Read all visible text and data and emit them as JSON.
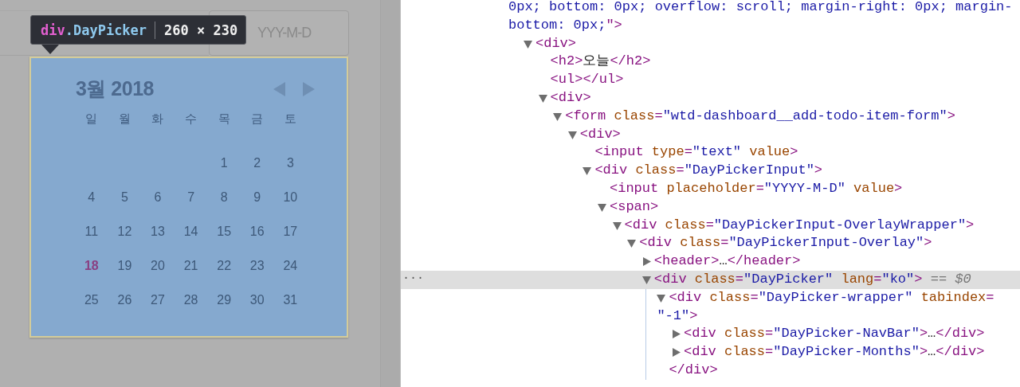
{
  "page": {
    "date_field": {
      "placeholder": "YYY-M-D"
    },
    "inspect_tooltip": {
      "tag": "div",
      "class_name": ".DayPicker",
      "size": "260 × 230"
    },
    "day_picker": {
      "caption": "3월 2018",
      "weekdays": [
        "일",
        "월",
        "화",
        "수",
        "목",
        "금",
        "토"
      ],
      "days": [
        {
          "kind": "blank"
        },
        {
          "kind": "blank"
        },
        {
          "kind": "blank"
        },
        {
          "kind": "blank"
        },
        {
          "kind": "day",
          "label": "1",
          "today": false
        },
        {
          "kind": "day",
          "label": "2",
          "today": false
        },
        {
          "kind": "day",
          "label": "3",
          "today": false
        },
        {
          "kind": "day",
          "label": "4",
          "today": false
        },
        {
          "kind": "day",
          "label": "5",
          "today": false
        },
        {
          "kind": "day",
          "label": "6",
          "today": false
        },
        {
          "kind": "day",
          "label": "7",
          "today": false
        },
        {
          "kind": "day",
          "label": "8",
          "today": false
        },
        {
          "kind": "day",
          "label": "9",
          "today": false
        },
        {
          "kind": "day",
          "label": "10",
          "today": false
        },
        {
          "kind": "day",
          "label": "11",
          "today": false
        },
        {
          "kind": "day",
          "label": "12",
          "today": false
        },
        {
          "kind": "day",
          "label": "13",
          "today": false
        },
        {
          "kind": "day",
          "label": "14",
          "today": false
        },
        {
          "kind": "day",
          "label": "15",
          "today": false
        },
        {
          "kind": "day",
          "label": "16",
          "today": false
        },
        {
          "kind": "day",
          "label": "17",
          "today": false
        },
        {
          "kind": "day",
          "label": "18",
          "today": true
        },
        {
          "kind": "day",
          "label": "19",
          "today": false
        },
        {
          "kind": "day",
          "label": "20",
          "today": false
        },
        {
          "kind": "day",
          "label": "21",
          "today": false
        },
        {
          "kind": "day",
          "label": "22",
          "today": false
        },
        {
          "kind": "day",
          "label": "23",
          "today": false
        },
        {
          "kind": "day",
          "label": "24",
          "today": false
        },
        {
          "kind": "day",
          "label": "25",
          "today": false
        },
        {
          "kind": "day",
          "label": "26",
          "today": false
        },
        {
          "kind": "day",
          "label": "27",
          "today": false
        },
        {
          "kind": "day",
          "label": "28",
          "today": false
        },
        {
          "kind": "day",
          "label": "29",
          "today": false
        },
        {
          "kind": "day",
          "label": "30",
          "today": false
        },
        {
          "kind": "day",
          "label": "31",
          "today": false
        }
      ]
    }
  },
  "elements_tree": {
    "selected_marker": "...",
    "root": {
      "selected": false,
      "lines": [
        [
          {
            "kind": "value",
            "text": "0px; bottom: 0px; overflow: scroll; margin-right: 0px; margin-"
          }
        ],
        [
          {
            "kind": "value",
            "text": "bottom: 0px;"
          },
          {
            "kind": "tag",
            "text": "\">"
          }
        ]
      ],
      "children": [
        {
          "selected": false,
          "expanded": true,
          "lines": [
            [
              {
                "kind": "tag",
                "text": "<div>"
              }
            ]
          ],
          "children": [
            {
              "selected": false,
              "lines": [
                [
                  {
                    "kind": "tag",
                    "text": "<h2>"
                  },
                  {
                    "kind": "text",
                    "text": "오늘"
                  },
                  {
                    "kind": "tag",
                    "text": "</h2>"
                  }
                ]
              ]
            },
            {
              "selected": false,
              "lines": [
                [
                  {
                    "kind": "tag",
                    "text": "<ul></ul>"
                  }
                ]
              ]
            },
            {
              "selected": false,
              "expanded": true,
              "lines": [
                [
                  {
                    "kind": "tag",
                    "text": "<div>"
                  }
                ]
              ],
              "children": [
                {
                  "selected": false,
                  "expanded": true,
                  "lines": [
                    [
                      {
                        "kind": "tag",
                        "text": "<form"
                      },
                      {
                        "kind": "attr",
                        "text": " class"
                      },
                      {
                        "kind": "tag",
                        "text": "="
                      },
                      {
                        "kind": "value",
                        "text": "\"wtd-dashboard__add-todo-item-form\""
                      },
                      {
                        "kind": "tag",
                        "text": ">"
                      }
                    ]
                  ],
                  "children": [
                    {
                      "selected": false,
                      "expanded": true,
                      "lines": [
                        [
                          {
                            "kind": "tag",
                            "text": "<div>"
                          }
                        ]
                      ],
                      "children": [
                        {
                          "selected": false,
                          "lines": [
                            [
                              {
                                "kind": "tag",
                                "text": "<input"
                              },
                              {
                                "kind": "attr",
                                "text": " type"
                              },
                              {
                                "kind": "tag",
                                "text": "="
                              },
                              {
                                "kind": "value",
                                "text": "\"text\""
                              },
                              {
                                "kind": "attr",
                                "text": " value"
                              },
                              {
                                "kind": "tag",
                                "text": ">"
                              }
                            ]
                          ]
                        },
                        {
                          "selected": false,
                          "expanded": true,
                          "lines": [
                            [
                              {
                                "kind": "tag",
                                "text": "<div"
                              },
                              {
                                "kind": "attr",
                                "text": " class"
                              },
                              {
                                "kind": "tag",
                                "text": "="
                              },
                              {
                                "kind": "value",
                                "text": "\"DayPickerInput\""
                              },
                              {
                                "kind": "tag",
                                "text": ">"
                              }
                            ]
                          ],
                          "children": [
                            {
                              "selected": false,
                              "lines": [
                                [
                                  {
                                    "kind": "tag",
                                    "text": "<input"
                                  },
                                  {
                                    "kind": "attr",
                                    "text": " placeholder"
                                  },
                                  {
                                    "kind": "tag",
                                    "text": "="
                                  },
                                  {
                                    "kind": "value",
                                    "text": "\"YYYY-M-D\""
                                  },
                                  {
                                    "kind": "attr",
                                    "text": " value"
                                  },
                                  {
                                    "kind": "tag",
                                    "text": ">"
                                  }
                                ]
                              ]
                            },
                            {
                              "selected": false,
                              "expanded": true,
                              "lines": [
                                [
                                  {
                                    "kind": "tag",
                                    "text": "<span>"
                                  }
                                ]
                              ],
                              "children": [
                                {
                                  "selected": false,
                                  "expanded": true,
                                  "lines": [
                                    [
                                      {
                                        "kind": "tag",
                                        "text": "<div"
                                      },
                                      {
                                        "kind": "attr",
                                        "text": " class"
                                      },
                                      {
                                        "kind": "tag",
                                        "text": "="
                                      },
                                      {
                                        "kind": "value",
                                        "text": "\"DayPickerInput-OverlayWrapper\""
                                      },
                                      {
                                        "kind": "tag",
                                        "text": ">"
                                      }
                                    ]
                                  ],
                                  "children": [
                                    {
                                      "selected": false,
                                      "expanded": true,
                                      "lines": [
                                        [
                                          {
                                            "kind": "tag",
                                            "text": "<div"
                                          },
                                          {
                                            "kind": "attr",
                                            "text": " class"
                                          },
                                          {
                                            "kind": "tag",
                                            "text": "="
                                          },
                                          {
                                            "kind": "value",
                                            "text": "\"DayPickerInput-Overlay\""
                                          },
                                          {
                                            "kind": "tag",
                                            "text": ">"
                                          }
                                        ]
                                      ],
                                      "children": [
                                        {
                                          "selected": false,
                                          "expanded": false,
                                          "lines": [
                                            [
                                              {
                                                "kind": "tag",
                                                "text": "<header>"
                                              },
                                              {
                                                "kind": "text",
                                                "text": "…"
                                              },
                                              {
                                                "kind": "tag",
                                                "text": "</header>"
                                              }
                                            ]
                                          ]
                                        },
                                        {
                                          "selected": true,
                                          "expanded": true,
                                          "lines": [
                                            [
                                              {
                                                "kind": "tag",
                                                "text": "<div"
                                              },
                                              {
                                                "kind": "attr",
                                                "text": " class"
                                              },
                                              {
                                                "kind": "tag",
                                                "text": "="
                                              },
                                              {
                                                "kind": "value",
                                                "text": "\"DayPicker\""
                                              },
                                              {
                                                "kind": "attr",
                                                "text": " lang"
                                              },
                                              {
                                                "kind": "tag",
                                                "text": "="
                                              },
                                              {
                                                "kind": "value",
                                                "text": "\"ko\""
                                              },
                                              {
                                                "kind": "tag",
                                                "text": ">"
                                              },
                                              {
                                                "kind": "hint",
                                                "text": " == $0"
                                              }
                                            ]
                                          ],
                                          "children": [
                                            {
                                              "selected": false,
                                              "expanded": true,
                                              "lines": [
                                                [
                                                  {
                                                    "kind": "tag",
                                                    "text": "<div"
                                                  },
                                                  {
                                                    "kind": "attr",
                                                    "text": " class"
                                                  },
                                                  {
                                                    "kind": "tag",
                                                    "text": "="
                                                  },
                                                  {
                                                    "kind": "value",
                                                    "text": "\"DayPicker-wrapper\""
                                                  },
                                                  {
                                                    "kind": "attr",
                                                    "text": " tabindex"
                                                  },
                                                  {
                                                    "kind": "tag",
                                                    "text": "="
                                                  }
                                                ],
                                                [
                                                  {
                                                    "kind": "value",
                                                    "text": "\"-1\""
                                                  },
                                                  {
                                                    "kind": "tag",
                                                    "text": ">"
                                                  }
                                                ]
                                              ],
                                              "close": [
                                                {
                                                  "kind": "tag",
                                                  "text": "</div>"
                                                }
                                              ],
                                              "children": [
                                                {
                                                  "selected": false,
                                                  "expanded": false,
                                                  "lines": [
                                                    [
                                                      {
                                                        "kind": "tag",
                                                        "text": "<div"
                                                      },
                                                      {
                                                        "kind": "attr",
                                                        "text": " class"
                                                      },
                                                      {
                                                        "kind": "tag",
                                                        "text": "="
                                                      },
                                                      {
                                                        "kind": "value",
                                                        "text": "\"DayPicker-NavBar\""
                                                      },
                                                      {
                                                        "kind": "tag",
                                                        "text": ">"
                                                      },
                                                      {
                                                        "kind": "text",
                                                        "text": "…"
                                                      },
                                                      {
                                                        "kind": "tag",
                                                        "text": "</div>"
                                                      }
                                                    ]
                                                  ]
                                                },
                                                {
                                                  "selected": false,
                                                  "expanded": false,
                                                  "lines": [
                                                    [
                                                      {
                                                        "kind": "tag",
                                                        "text": "<div"
                                                      },
                                                      {
                                                        "kind": "attr",
                                                        "text": " class"
                                                      },
                                                      {
                                                        "kind": "tag",
                                                        "text": "="
                                                      },
                                                      {
                                                        "kind": "value",
                                                        "text": "\"DayPicker-Months\""
                                                      },
                                                      {
                                                        "kind": "tag",
                                                        "text": ">"
                                                      },
                                                      {
                                                        "kind": "text",
                                                        "text": "…"
                                                      },
                                                      {
                                                        "kind": "tag",
                                                        "text": "</div>"
                                                      }
                                                    ]
                                                  ]
                                                }
                                              ]
                                            }
                                          ]
                                        }
                                      ]
                                    }
                                  ]
                                }
                              ]
                            }
                          ]
                        }
                      ]
                    }
                  ]
                }
              ]
            }
          ]
        }
      ]
    }
  }
}
